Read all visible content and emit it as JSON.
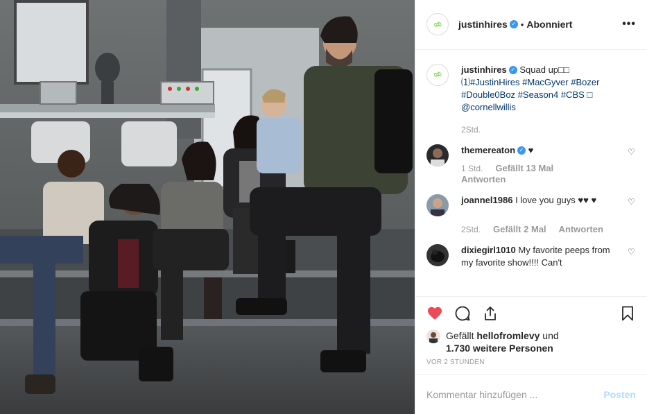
{
  "photo": {
    "alt": ""
  },
  "header": {
    "username": "justinhires",
    "separator": "•",
    "follow_label": "Abonniert",
    "avatar_text": "ಯ"
  },
  "caption": {
    "username": "justinhires",
    "text_lead": "Squad up□□",
    "line2": "⑴#JustinHires #MacGyver #Bozer",
    "line3": "#Double0Boz #Season4 #CBS □",
    "line4": "@cornellwillis",
    "time": "2Std."
  },
  "comments": [
    {
      "username": "themereaton",
      "text": "♥",
      "time": "1 Std.",
      "likes": "Gefällt 13 Mal",
      "reply": "Antworten"
    },
    {
      "username": "joannel1986",
      "text": "I love you guys ♥♥ ♥",
      "time": "2Std.",
      "likes": "Gefällt 2 Mal",
      "reply": "Antworten"
    },
    {
      "username": "dixiegirl1010",
      "text": "My favorite peeps from my favorite show!!!! Can't",
      "time": "",
      "likes": "",
      "reply": ""
    }
  ],
  "likes": {
    "prefix": "Gefällt ",
    "user": "hellofromlevy",
    "middle": " und",
    "count": "1.730 weitere Personen"
  },
  "timestamp": "VOR 2 STUNDEN",
  "add_comment": {
    "placeholder": "Kommentar hinzufügen ...",
    "post_label": "Posten"
  },
  "colors": {
    "like_red": "#ed4956",
    "link_blue": "#003569",
    "verified_blue": "#3897f0",
    "post_disabled": "#b3dbff"
  }
}
